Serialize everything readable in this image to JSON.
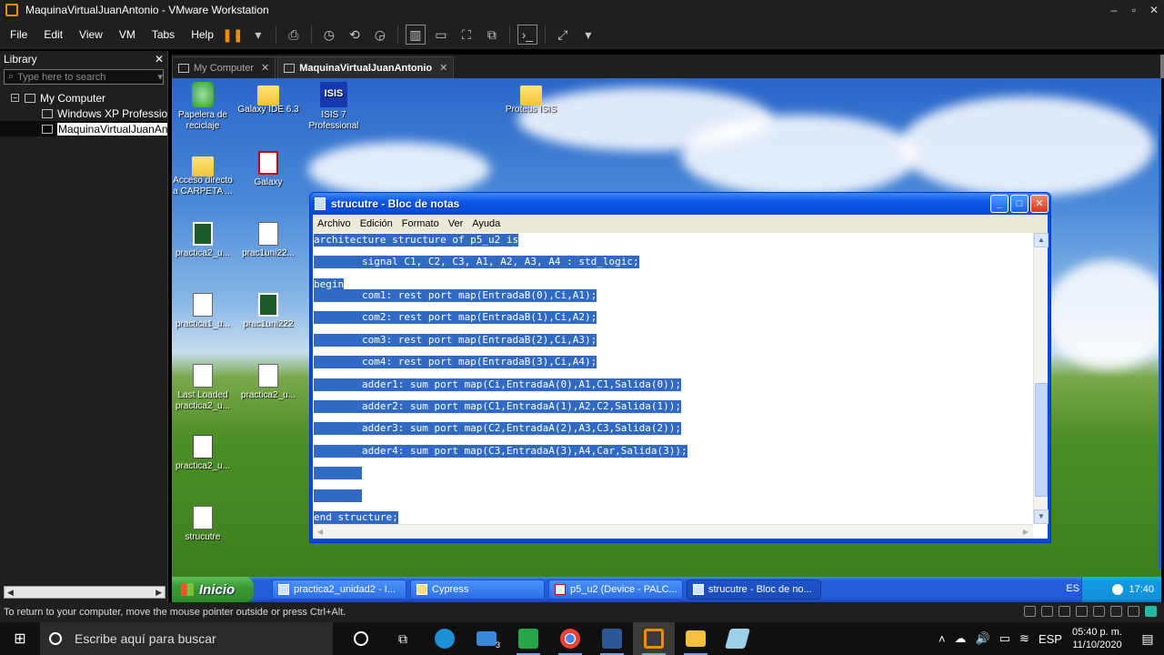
{
  "vmware": {
    "title": "MaquinaVirtualJuanAntonio - VMware Workstation",
    "menu": [
      "File",
      "Edit",
      "View",
      "VM",
      "Tabs",
      "Help"
    ],
    "library": {
      "heading": "Library",
      "search_placeholder": "Type here to search",
      "tree": {
        "root": "My Computer",
        "children": [
          "Windows XP Professional",
          "MaquinaVirtualJuanAntonio"
        ]
      }
    },
    "tabs": [
      {
        "label": "My Computer",
        "active": false
      },
      {
        "label": "MaquinaVirtualJuanAntonio",
        "active": true
      }
    ],
    "status_text": "To return to your computer, move the mouse pointer outside or press Ctrl+Alt."
  },
  "desktop": {
    "icons": [
      {
        "label": "Papelera de reciclaje",
        "icon": "recycle-bin-icon"
      },
      {
        "label": "Galaxy IDE 6.3",
        "icon": "folder-icon"
      },
      {
        "label": "ISIS 7 Professional",
        "icon": "isis-icon"
      },
      {
        "label": "Proteus ISIS",
        "icon": "folder-icon"
      },
      {
        "label": "Acceso directo a CARPETA ...",
        "icon": "folder-icon"
      },
      {
        "label": "Galaxy",
        "icon": "galaxy-icon"
      },
      {
        "label": "practica2_u...",
        "icon": "chip-icon"
      },
      {
        "label": "prac1uni22...",
        "icon": "document-icon"
      },
      {
        "label": "practica1_u...",
        "icon": "document-icon"
      },
      {
        "label": "prac1uni222",
        "icon": "chip-icon"
      },
      {
        "label": "Last Loaded practica2_u...",
        "icon": "document-icon"
      },
      {
        "label": "practica2_u...",
        "icon": "document-icon"
      },
      {
        "label": "practica2_u...",
        "icon": "cad-icon"
      },
      {
        "label": "strucutre",
        "icon": "text-file-icon"
      }
    ]
  },
  "notepad": {
    "title": "strucutre - Bloc de notas",
    "menu": [
      "Archivo",
      "Edición",
      "Formato",
      "Ver",
      "Ayuda"
    ],
    "lines": [
      "architecture structure of p5_u2 is",
      "",
      "        signal C1, C2, C3, A1, A2, A3, A4 : std_logic;",
      "",
      "begin",
      "        com1: rest port map(EntradaB(0),Ci,A1);",
      "",
      "        com2: rest port map(EntradaB(1),Ci,A2);",
      "",
      "        com3: rest port map(EntradaB(2),Ci,A3);",
      "",
      "        com4: rest port map(EntradaB(3),Ci,A4);",
      "",
      "        adder1: sum port map(Ci,EntradaA(0),A1,C1,Salida(0));",
      "",
      "        adder2: sum port map(C1,EntradaA(1),A2,C2,Salida(1));",
      "",
      "        adder3: sum port map(C2,EntradaA(2),A3,C3,Salida(2));",
      "",
      "        adder4: sum port map(C3,EntradaA(3),A4,Car,Salida(3));",
      "",
      "        ",
      "",
      "        ",
      "",
      "end structure;"
    ]
  },
  "xp_taskbar": {
    "start_label": "Inicio",
    "tasks": [
      {
        "label": "practica2_unidad2 - I...",
        "active": false
      },
      {
        "label": "Cypress",
        "active": false
      },
      {
        "label": "p5_u2 (Device - PALC...",
        "active": false
      },
      {
        "label": "strucutre - Bloc de no...",
        "active": true
      }
    ],
    "lang": "ES",
    "time": "17:40"
  },
  "win_taskbar": {
    "search_placeholder": "Escribe aquí para buscar",
    "mail_badge": "3",
    "lang": "ESP",
    "time": "05:40 p. m.",
    "date": "11/10/2020"
  }
}
